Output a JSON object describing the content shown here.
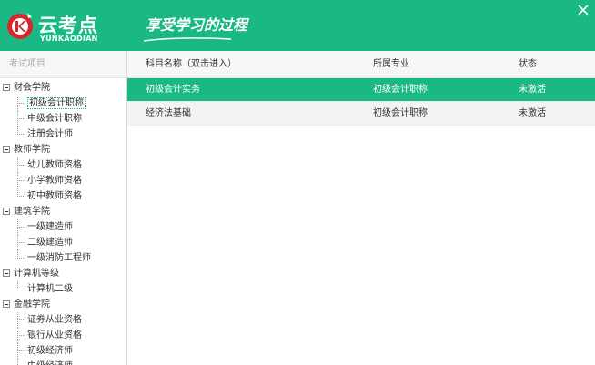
{
  "header": {
    "logo_cn": "云考点",
    "logo_en": "YUNKAODIAN",
    "slogan": "享受学习的过程"
  },
  "sidebar": {
    "title": "考试项目",
    "categories": [
      {
        "label": "财会学院",
        "children": [
          "初级会计职称",
          "中级会计职称",
          "注册会计师"
        ]
      },
      {
        "label": "教师学院",
        "children": [
          "幼儿教师资格",
          "小学教师资格",
          "初中教师资格"
        ]
      },
      {
        "label": "建筑学院",
        "children": [
          "一级建造师",
          "二级建造师",
          "一级消防工程师"
        ]
      },
      {
        "label": "计算机等级",
        "children": [
          "计算机二级"
        ]
      },
      {
        "label": "金融学院",
        "children": [
          "证券从业资格",
          "银行从业资格",
          "初级经济师",
          "中级经济师"
        ]
      }
    ],
    "selected": "初级会计职称"
  },
  "table": {
    "columns": [
      "科目名称（双击进入）",
      "所属专业",
      "状态"
    ],
    "rows": [
      {
        "name": "初级会计实务",
        "major": "初级会计职称",
        "status": "未激活"
      },
      {
        "name": "经济法基础",
        "major": "初级会计职称",
        "status": "未激活"
      }
    ]
  },
  "colors": {
    "brand": "#1ab885",
    "logo_red": "#d9262b"
  },
  "icons": {
    "close": "close-icon",
    "logo": "logo-icon"
  }
}
